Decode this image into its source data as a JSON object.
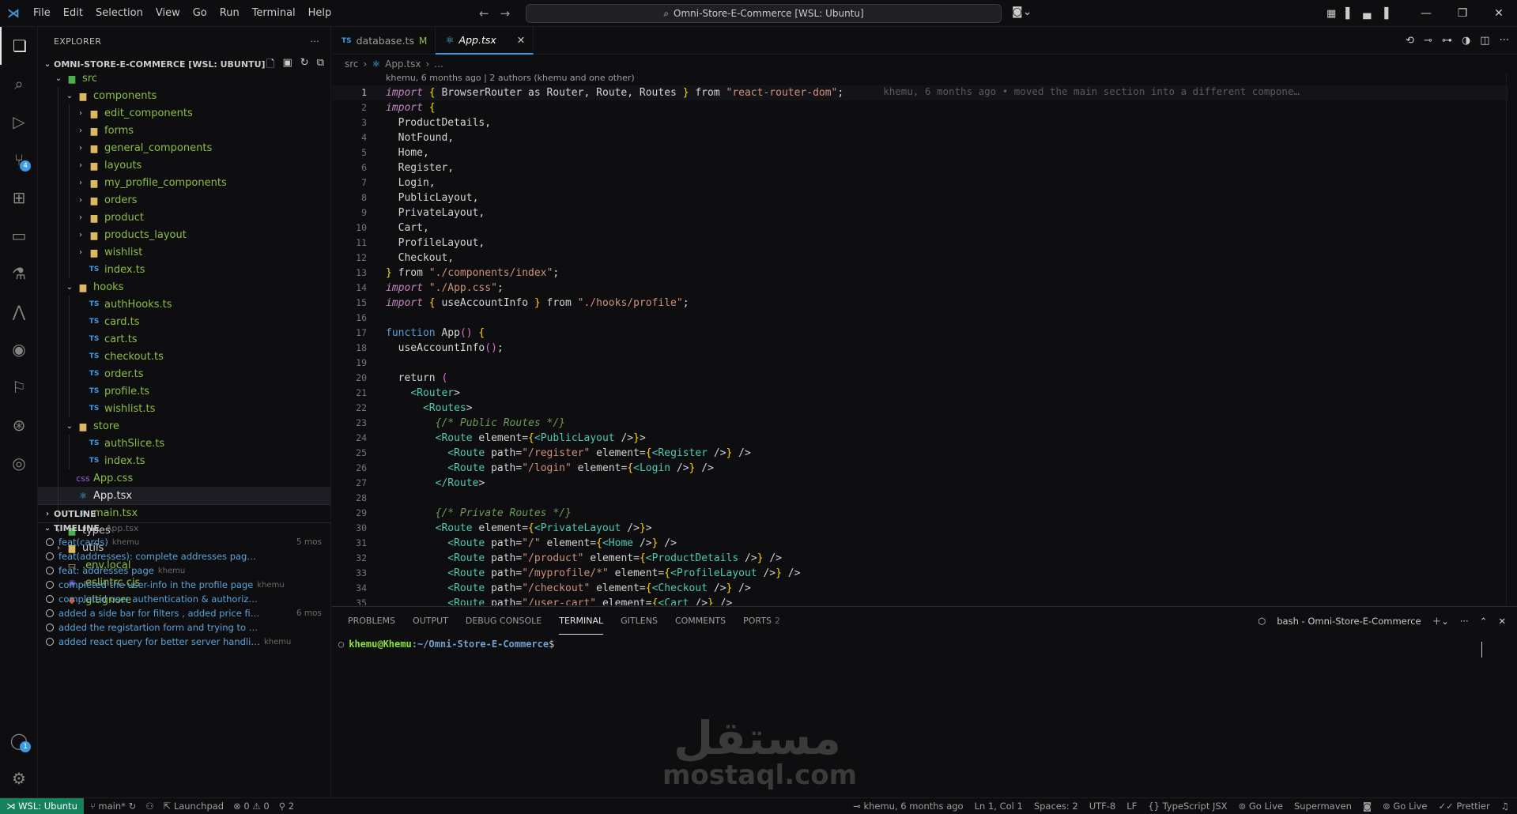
{
  "titlebar": {
    "menu": [
      "File",
      "Edit",
      "Selection",
      "View",
      "Go",
      "Run",
      "Terminal",
      "Help"
    ],
    "search_text": "Omni-Store-E-Commerce [WSL: Ubuntu]"
  },
  "activity": {
    "scm_badge": "4",
    "accounts_badge": "1"
  },
  "explorer": {
    "title": "EXPLORER",
    "root": "OMNI-STORE-E-COMMERCE [WSL: UBUNTU]",
    "tree": [
      {
        "label": "src",
        "depth": 1,
        "type": "folder-open",
        "icon": "folder-green"
      },
      {
        "label": "components",
        "depth": 2,
        "type": "folder-open",
        "icon": "folder"
      },
      {
        "label": "edit_components",
        "depth": 3,
        "type": "folder",
        "icon": "folder"
      },
      {
        "label": "forms",
        "depth": 3,
        "type": "folder",
        "icon": "folder"
      },
      {
        "label": "general_components",
        "depth": 3,
        "type": "folder",
        "icon": "folder"
      },
      {
        "label": "layouts",
        "depth": 3,
        "type": "folder",
        "icon": "folder"
      },
      {
        "label": "my_profile_components",
        "depth": 3,
        "type": "folder",
        "icon": "folder"
      },
      {
        "label": "orders",
        "depth": 3,
        "type": "folder",
        "icon": "folder"
      },
      {
        "label": "product",
        "depth": 3,
        "type": "folder",
        "icon": "folder"
      },
      {
        "label": "products_layout",
        "depth": 3,
        "type": "folder",
        "icon": "folder"
      },
      {
        "label": "wishlist",
        "depth": 3,
        "type": "folder",
        "icon": "folder"
      },
      {
        "label": "index.ts",
        "depth": 3,
        "type": "file",
        "icon": "ts"
      },
      {
        "label": "hooks",
        "depth": 2,
        "type": "folder-open",
        "icon": "folder"
      },
      {
        "label": "authHooks.ts",
        "depth": 3,
        "type": "file",
        "icon": "ts"
      },
      {
        "label": "card.ts",
        "depth": 3,
        "type": "file",
        "icon": "ts"
      },
      {
        "label": "cart.ts",
        "depth": 3,
        "type": "file",
        "icon": "ts"
      },
      {
        "label": "checkout.ts",
        "depth": 3,
        "type": "file",
        "icon": "ts"
      },
      {
        "label": "order.ts",
        "depth": 3,
        "type": "file",
        "icon": "ts"
      },
      {
        "label": "profile.ts",
        "depth": 3,
        "type": "file",
        "icon": "ts"
      },
      {
        "label": "wishlist.ts",
        "depth": 3,
        "type": "file",
        "icon": "ts"
      },
      {
        "label": "store",
        "depth": 2,
        "type": "folder-open",
        "icon": "folder"
      },
      {
        "label": "authSlice.ts",
        "depth": 3,
        "type": "file",
        "icon": "ts"
      },
      {
        "label": "index.ts",
        "depth": 3,
        "type": "file",
        "icon": "ts"
      },
      {
        "label": "App.css",
        "depth": 2,
        "type": "file",
        "icon": "css"
      },
      {
        "label": "App.tsx",
        "depth": 2,
        "type": "file",
        "icon": "react",
        "active": true
      },
      {
        "label": "main.tsx",
        "depth": 2,
        "type": "file",
        "icon": "react"
      },
      {
        "label": "types",
        "depth": 1,
        "type": "folder",
        "icon": "folder-green"
      },
      {
        "label": "utils",
        "depth": 1,
        "type": "folder",
        "icon": "folder"
      },
      {
        "label": ".env.local",
        "depth": 1,
        "type": "file",
        "icon": "env"
      },
      {
        "label": ".eslintrc.cjs",
        "depth": 1,
        "type": "file",
        "icon": "eslint"
      },
      {
        "label": ".gitignore",
        "depth": 1,
        "type": "file",
        "icon": "git"
      }
    ],
    "outline_title": "OUTLINE",
    "timeline_title": "TIMELINE",
    "timeline_file": "App.tsx",
    "timeline": [
      {
        "msg": "feat(cards)",
        "author": "khemu",
        "time": "5 mos"
      },
      {
        "msg": "feat(addresses): complete addresses page with its fu...",
        "author": "",
        "time": ""
      },
      {
        "msg": "feat: addresses page",
        "author": "khemu",
        "time": ""
      },
      {
        "msg": "completed the user-info in the profile page",
        "author": "khemu",
        "time": ""
      },
      {
        "msg": "completed user authentication & authorization usin...",
        "author": "",
        "time": ""
      },
      {
        "msg": "added a side bar for filters , added price filter,ad...",
        "author": "",
        "time": "6 mos"
      },
      {
        "msg": "added the registartion form and trying to add the p...",
        "author": "",
        "time": ""
      },
      {
        "msg": "added react query  for better server handling",
        "author": "khemu",
        "time": ""
      }
    ]
  },
  "tabs": [
    {
      "label": "database.ts",
      "mark": "M",
      "active": false
    },
    {
      "label": "App.tsx",
      "mark": "",
      "active": true
    }
  ],
  "breadcrumb": {
    "folder": "src",
    "file": "App.tsx",
    "rest": "..."
  },
  "blame": {
    "header": "khemu, 6 months ago | 2 authors (khemu and one other)",
    "inline": "khemu, 6 months ago • moved the main section into a different compone…"
  },
  "code_lines": [
    "import { BrowserRouter as Router, Route, Routes } from \"react-router-dom\";",
    "import {",
    "  ProductDetails,",
    "  NotFound,",
    "  Home,",
    "  Register,",
    "  Login,",
    "  PublicLayout,",
    "  PrivateLayout,",
    "  Cart,",
    "  ProfileLayout,",
    "  Checkout,",
    "} from \"./components/index\";",
    "import \"./App.css\";",
    "import { useAccountInfo } from \"./hooks/profile\";",
    "",
    "function App() {",
    "  useAccountInfo();",
    "",
    "  return (",
    "    <Router>",
    "      <Routes>",
    "        {/* Public Routes */}",
    "        <Route element={<PublicLayout />}>",
    "          <Route path=\"/register\" element={<Register />} />",
    "          <Route path=\"/login\" element={<Login />} />",
    "        </Route>",
    "",
    "        {/* Private Routes */}",
    "        <Route element={<PrivateLayout />}>",
    "          <Route path=\"/\" element={<Home />} />",
    "          <Route path=\"/product\" element={<ProductDetails />} />",
    "          <Route path=\"/myprofile/*\" element={<ProfileLayout />} />",
    "          <Route path=\"/checkout\" element={<Checkout />} />",
    "          <Route path=\"/user-cart\" element={<Cart />} />"
  ],
  "panel": {
    "tabs": [
      "PROBLEMS",
      "OUTPUT",
      "DEBUG CONSOLE",
      "TERMINAL",
      "GITLENS",
      "COMMENTS",
      "PORTS"
    ],
    "active_tab": "TERMINAL",
    "ports_count": "2",
    "terminal_name": "bash - Omni-Store-E-Commerce",
    "prompt_user": "khemu@Khemu",
    "prompt_path": ":~/Omni-Store-E-Commerce",
    "prompt_end": "$"
  },
  "watermark": {
    "arabic": "مستقل",
    "latin": "mostaql.com"
  },
  "statusbar": {
    "remote": "WSL: Ubuntu",
    "branch": "main*",
    "launchpad": "Launchpad",
    "errors": "0",
    "warnings": "0",
    "ports": "2",
    "blame": "khemu, 6 months ago",
    "position": "Ln 1, Col 1",
    "spaces": "Spaces: 2",
    "encoding": "UTF-8",
    "eol": "LF",
    "language": "TypeScript JSX",
    "golive1": "Go Live",
    "supermaven": "Supermaven",
    "golive2": "Go Live",
    "prettier": "Prettier"
  }
}
